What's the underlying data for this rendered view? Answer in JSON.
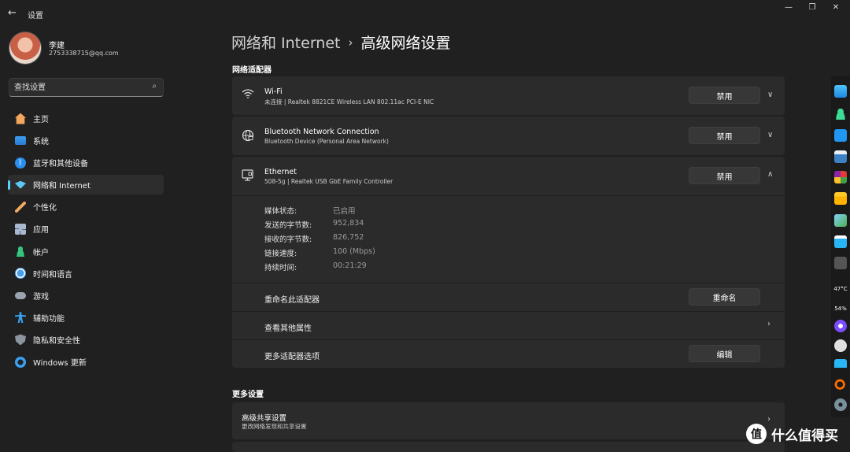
{
  "window": {
    "title": "设置",
    "back_glyph": "←",
    "minimize_glyph": "—",
    "maximize_glyph": "❐",
    "close_glyph": "✕"
  },
  "profile": {
    "name": "李建",
    "email": "2753338715@qq.com"
  },
  "search": {
    "placeholder": "查找设置",
    "icon": "search-icon"
  },
  "sidebar": {
    "items": [
      {
        "label": "主页",
        "icon": "home-icon",
        "color": "#f2a75a"
      },
      {
        "label": "系统",
        "icon": "system-icon",
        "color": "#3aa0f0"
      },
      {
        "label": "蓝牙和其他设备",
        "icon": "bluetooth-icon",
        "color": "#2a8ef0"
      },
      {
        "label": "网络和 Internet",
        "icon": "wifi-icon",
        "color": "#5cc8f5"
      },
      {
        "label": "个性化",
        "icon": "brush-icon",
        "color": "#f0a860"
      },
      {
        "label": "应用",
        "icon": "apps-icon",
        "color": "#a8b8d0"
      },
      {
        "label": "帐户",
        "icon": "account-icon",
        "color": "#34c47c"
      },
      {
        "label": "时间和语言",
        "icon": "globe-clock-icon",
        "color": "#4aa0e8"
      },
      {
        "label": "游戏",
        "icon": "gamepad-icon",
        "color": "#9aa4b0"
      },
      {
        "label": "辅助功能",
        "icon": "accessibility-icon",
        "color": "#3aa0f0"
      },
      {
        "label": "隐私和安全性",
        "icon": "shield-icon",
        "color": "#8c94a0"
      },
      {
        "label": "Windows 更新",
        "icon": "update-icon",
        "color": "#3aa0f0"
      }
    ],
    "active_index": 3
  },
  "breadcrumb": {
    "parent": "网络和 Internet",
    "separator": "›",
    "current": "高级网络设置"
  },
  "adapters": {
    "section_title": "网络适配器",
    "wifi": {
      "name": "Wi-Fi",
      "description": "未连接 | Realtek 8821CE Wireless LAN 802.11ac PCI-E NIC",
      "button": "禁用",
      "icon": "wifi-icon"
    },
    "bluetooth": {
      "name": "Bluetooth Network Connection",
      "description": "Bluetooth Device (Personal Area Network)",
      "button": "禁用",
      "icon": "globe-network-icon"
    },
    "ethernet": {
      "name": "Ethernet",
      "description": "508-5g | Realtek USB GbE Family Controller",
      "button": "禁用",
      "icon": "ethernet-icon",
      "details": [
        {
          "label": "媒体状态:",
          "value": "已启用"
        },
        {
          "label": "发送的字节数:",
          "value": "952,834"
        },
        {
          "label": "接收的字节数:",
          "value": "826,752"
        },
        {
          "label": "链接速度:",
          "value": "100 (Mbps)"
        },
        {
          "label": "持续时间:",
          "value": "00:21:29"
        }
      ],
      "rename_label": "重命名此适配器",
      "rename_button": "重命名",
      "properties_label": "查看其他属性",
      "more_options_label": "更多适配器选项",
      "edit_button": "编辑"
    }
  },
  "more_settings": {
    "section_title": "更多设置",
    "sharing_title": "高级共享设置",
    "sharing_sub": "更改网络发现和共享设置"
  },
  "taskbar": {
    "temperature": "47°C",
    "percent": "54%"
  },
  "watermark": {
    "logo": "值",
    "text": "什么值得买"
  }
}
